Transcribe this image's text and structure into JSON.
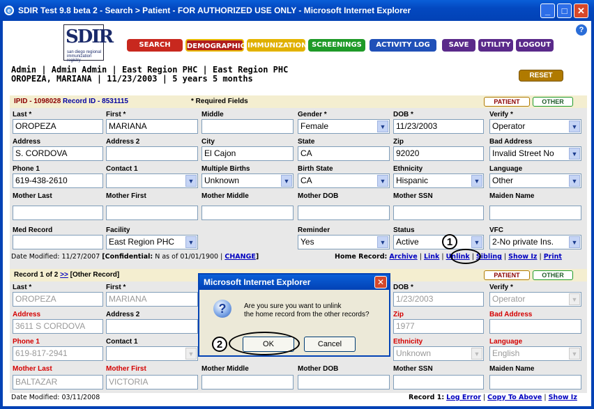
{
  "window": {
    "title": "SDIR Test 9.8 beta 2 - Search > Patient - FOR AUTHORIZED USE ONLY - Microsoft Internet Explorer"
  },
  "logo": {
    "text": "SDIR",
    "subtext": "san diego regional immunization registry"
  },
  "nav": {
    "search": "SEARCH",
    "demographics": "DEMOGRAPHICS",
    "immunization": "IMMUNIZATION",
    "screenings": "SCREENINGS",
    "activity_log": "ACTIVITY LOG",
    "save": "SAVE",
    "utility": "UTILITY",
    "logout": "LOGOUT",
    "help": "?"
  },
  "user": {
    "line1": "Admin | Admin Admin | East Region PHC | East Region PHC",
    "line2": "OROPEZA, MARIANA | 11/23/2003 | 5 years 5 months"
  },
  "reset_label": "RESET",
  "patient": {
    "header": {
      "ipid": "IPID - 1098028",
      "record_id": "Record ID - 8531115",
      "required": "* Required Fields",
      "patient_tab": "PATIENT",
      "other_tab": "OTHER"
    },
    "labels": {
      "last": "Last *",
      "first": "First *",
      "middle": "Middle",
      "gender": "Gender *",
      "dob": "DOB *",
      "verify": "Verify *",
      "address": "Address",
      "address2": "Address 2",
      "city": "City",
      "state": "State",
      "zip": "Zip",
      "bad_address": "Bad Address",
      "phone1": "Phone 1",
      "contact1": "Contact 1",
      "multiple_births": "Multiple Births",
      "birth_state": "Birth State",
      "ethnicity": "Ethnicity",
      "language": "Language",
      "mother_last": "Mother Last",
      "mother_first": "Mother First",
      "mother_middle": "Mother Middle",
      "mother_dob": "Mother DOB",
      "mother_ssn": "Mother SSN",
      "maiden_name": "Maiden Name",
      "med_record": "Med Record",
      "facility": "Facility",
      "reminder": "Reminder",
      "status": "Status",
      "vfc": "VFC"
    },
    "values": {
      "last": "OROPEZA",
      "first": "MARIANA",
      "middle": "",
      "gender": "Female",
      "dob": "11/23/2003",
      "verify": "Operator",
      "address": "S. CORDOVA",
      "address2": "",
      "city": "El Cajon",
      "state": "CA",
      "zip": "92020",
      "bad_address": "Invalid Street No",
      "phone1": "619-438-2610",
      "contact1": "",
      "multiple_births": "Unknown",
      "birth_state": "CA",
      "ethnicity": "Hispanic",
      "language": "Other",
      "facility": "East Region PHC",
      "reminder": "Yes",
      "status": "Active",
      "vfc": "2-No private Ins."
    },
    "footer": {
      "date_modified": "Date Modified: 11/27/2007",
      "confidential": "[Confidential:",
      "confidential_rest": "N as of 01/01/1900 |",
      "change": "CHANGE",
      "close": "]",
      "home_record": "Home Record:",
      "archive": "Archive",
      "link": "Link",
      "unlink": "Unlink",
      "sibling": "Sibling",
      "show_iz": "Show Iz",
      "print": "Print"
    }
  },
  "other": {
    "header": {
      "record": "Record 1 of 2",
      "next": ">>",
      "other_record": "[Other Record]",
      "patient_tab": "PATIENT",
      "other_tab": "OTHER"
    },
    "labels": {
      "last": "Last *",
      "first": "First *",
      "dob": "DOB *",
      "verify": "Verify *",
      "address": "Address",
      "address2": "Address 2",
      "zip": "Zip",
      "bad_address": "Bad Address",
      "phone1": "Phone 1",
      "contact1": "Contact 1",
      "ethnicity": "Ethnicity",
      "language": "Language",
      "mother_last": "Mother Last",
      "mother_first": "Mother First",
      "mother_middle": "Mother Middle",
      "mother_dob": "Mother DOB",
      "mother_ssn": "Mother SSN",
      "maiden_name": "Maiden Name"
    },
    "values": {
      "last": "OROPEZA",
      "first": "MARIANA",
      "dob": "1/23/2003",
      "verify": "Operator",
      "address": "3611 S CORDOVA",
      "zip": "1977",
      "phone1": "619-817-2941",
      "ethnicity": "Unknown",
      "language": "English",
      "mother_last": "BALTAZAR",
      "mother_first": "VICTORIA"
    },
    "footer": {
      "date_modified": "Date Modified: 03/11/2008",
      "record1": "Record 1:",
      "log_error": "Log Error",
      "copy_to_above": "Copy To Above",
      "show_iz": "Show Iz"
    }
  },
  "dialog": {
    "title": "Microsoft Internet Explorer",
    "message_line1": "Are you sure you want to unlink",
    "message_line2": "the home record from the other records?",
    "ok": "OK",
    "cancel": "Cancel"
  },
  "annotations": {
    "one": "1",
    "two": "2"
  }
}
